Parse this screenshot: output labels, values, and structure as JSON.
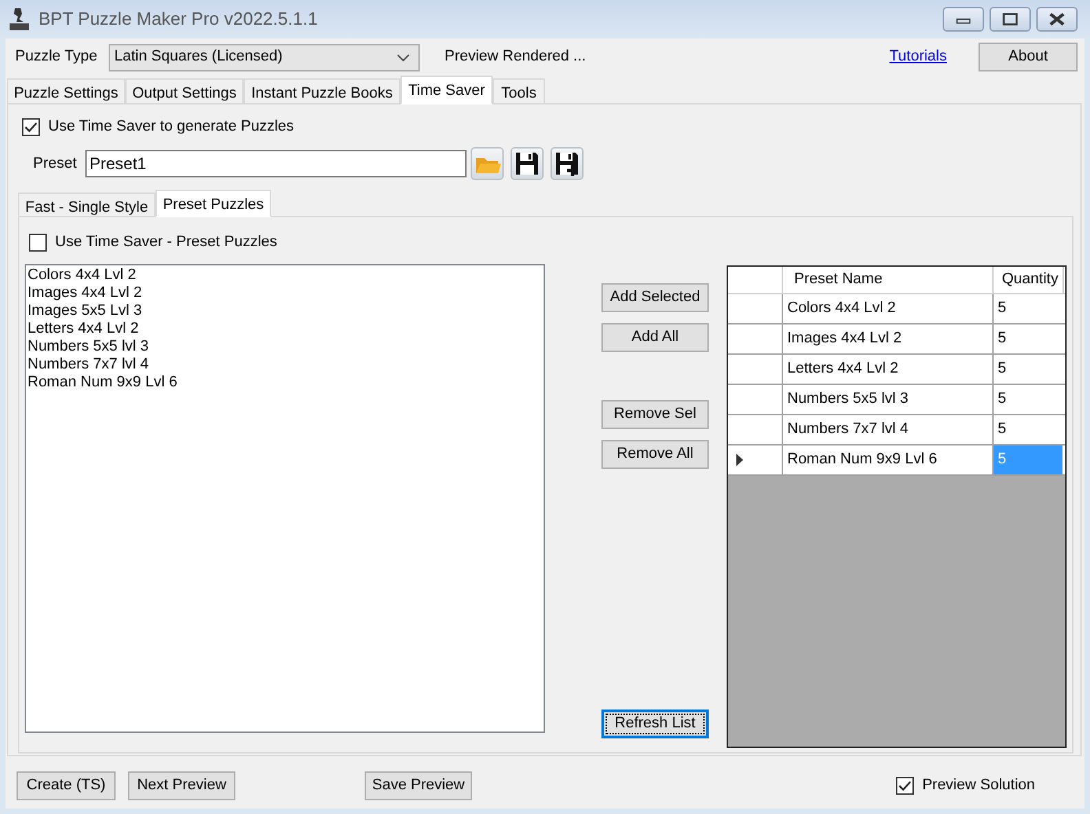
{
  "window": {
    "title": "BPT Puzzle Maker Pro v2022.5.1.1"
  },
  "toolbar": {
    "puzzle_type_label": "Puzzle Type",
    "puzzle_type": "Latin Squares (Licensed)",
    "status": "Preview Rendered ...",
    "tutorials_link": "Tutorials",
    "about_button": "About"
  },
  "tabs": [
    {
      "label": "Puzzle Settings",
      "selected": false
    },
    {
      "label": "Output Settings",
      "selected": false
    },
    {
      "label": "Instant Puzzle Books",
      "selected": false
    },
    {
      "label": "Time Saver",
      "selected": true
    },
    {
      "label": "Tools",
      "selected": false
    }
  ],
  "time_saver": {
    "use_checkbox": {
      "label": "Use Time Saver to generate Puzzles",
      "checked": true
    },
    "preset_label": "Preset",
    "preset_value": "Preset1",
    "sub_tabs": [
      {
        "label": "Fast - Single Style",
        "selected": false
      },
      {
        "label": "Preset Puzzles",
        "selected": true
      }
    ],
    "preset_checkbox": {
      "label": "Use Time Saver - Preset Puzzles",
      "checked": false
    },
    "available_presets": [
      "Colors 4x4 Lvl 2",
      "Images 4x4 Lvl 2",
      "Images 5x5 Lvl 3",
      "Letters 4x4 Lvl 2",
      "Numbers 5x5 lvl 3",
      "Numbers 7x7 lvl 4",
      "Roman Num 9x9 Lvl 6"
    ],
    "button_groups": [
      [
        "Add Selected",
        "Add All"
      ],
      [
        "Remove Sel",
        "Remove All"
      ]
    ],
    "refresh_button": {
      "label": "Refresh List",
      "focused": true
    },
    "grid": {
      "columns": [
        "Preset Name",
        "Quantity"
      ],
      "rows": [
        {
          "name": "Colors 4x4 Lvl 2",
          "quantity": "5",
          "current": false,
          "quantity_selected": false
        },
        {
          "name": "Images 4x4 Lvl 2",
          "quantity": "5",
          "current": false,
          "quantity_selected": false
        },
        {
          "name": "Letters 4x4 Lvl 2",
          "quantity": "5",
          "current": false,
          "quantity_selected": false
        },
        {
          "name": "Numbers 5x5 lvl 3",
          "quantity": "5",
          "current": false,
          "quantity_selected": false
        },
        {
          "name": "Numbers 7x7 lvl 4",
          "quantity": "5",
          "current": false,
          "quantity_selected": false
        },
        {
          "name": "Roman Num 9x9 Lvl 6",
          "quantity": "5",
          "current": true,
          "quantity_selected": true
        }
      ]
    }
  },
  "footer": {
    "left_buttons": [
      "Create (TS)",
      "Next Preview"
    ],
    "center_button": "Save Preview",
    "preview_solution": {
      "label": "Preview Solution",
      "checked": true
    }
  }
}
